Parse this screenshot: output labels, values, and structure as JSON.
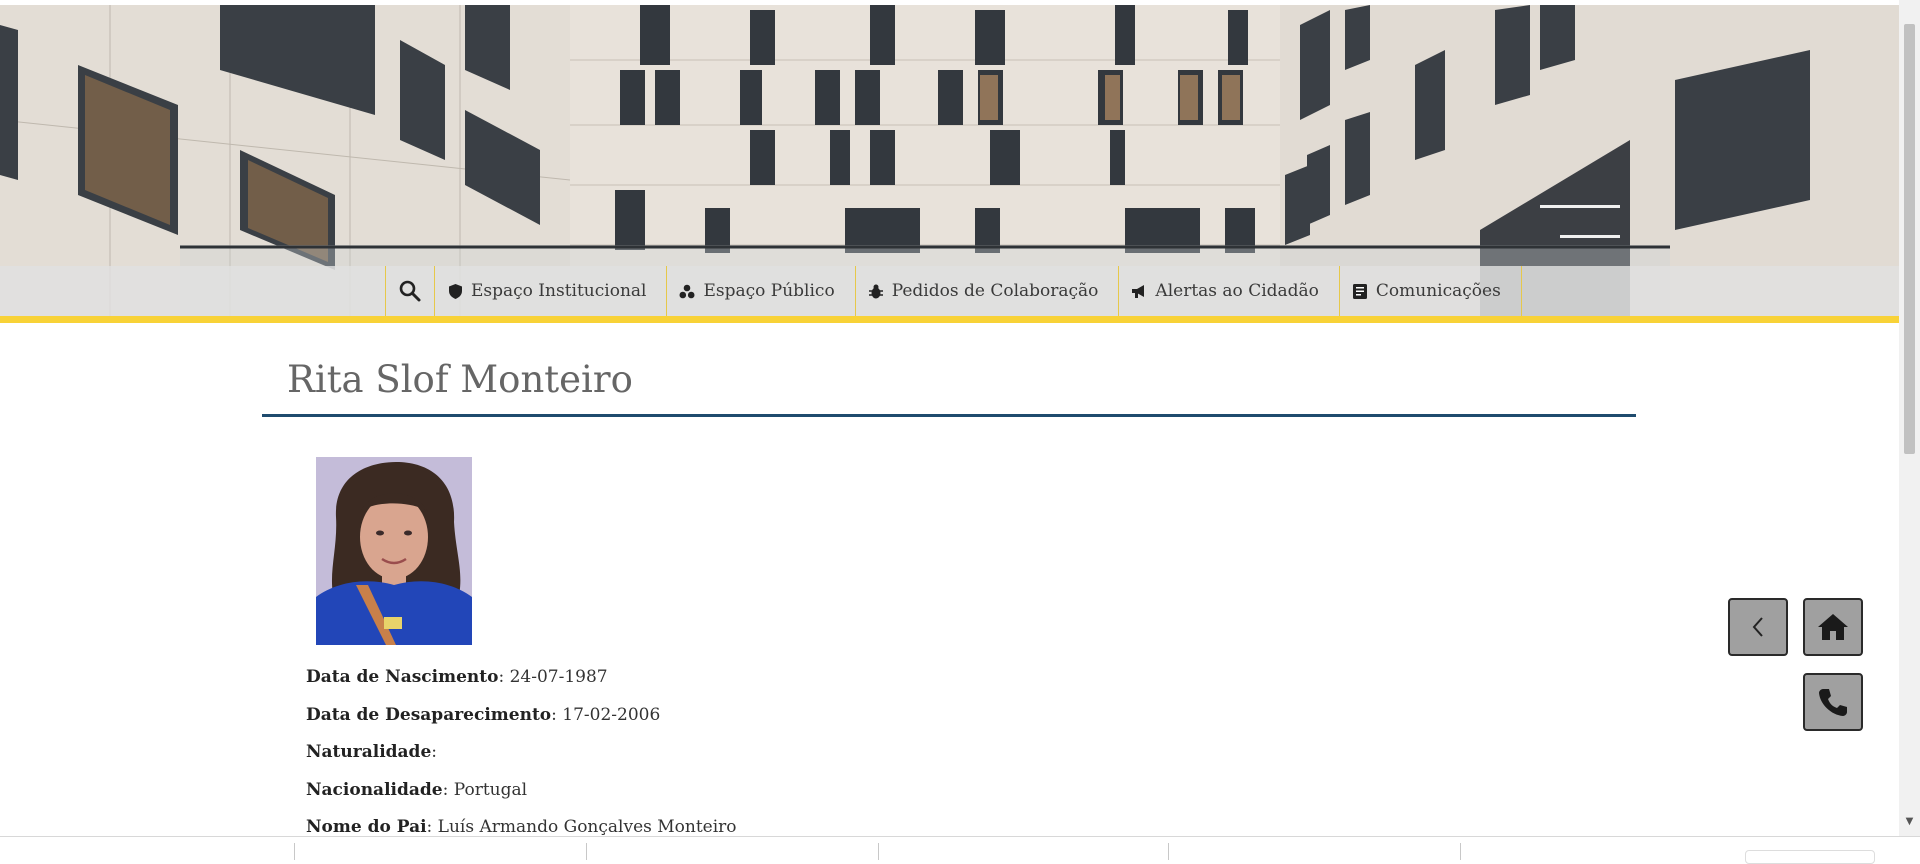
{
  "nav": {
    "items": [
      {
        "label": "Espaço Institucional",
        "icon": "shield-icon"
      },
      {
        "label": "Espaço Público",
        "icon": "people-icon"
      },
      {
        "label": "Pedidos de Colaboração",
        "icon": "bug-icon"
      },
      {
        "label": "Alertas ao Cidadão",
        "icon": "megaphone-icon"
      },
      {
        "label": "Comunicações",
        "icon": "document-icon"
      }
    ]
  },
  "page": {
    "title": "Rita Slof Monteiro"
  },
  "details": [
    {
      "label": "Data de Nascimento",
      "value": ": 24-07-1987"
    },
    {
      "label": "Data de Desaparecimento",
      "value": ": 17-02-2006"
    },
    {
      "label": "Naturalidade",
      "value": ":"
    },
    {
      "label": "Nacionalidade",
      "value": ": Portugal"
    },
    {
      "label": "Nome do Pai",
      "value": ": Luís Armando Gonçalves Monteiro"
    }
  ],
  "colors": {
    "accent_yellow": "#f8d237",
    "title_rule": "#1f4b6e",
    "button_gray": "#a0a0a0"
  }
}
